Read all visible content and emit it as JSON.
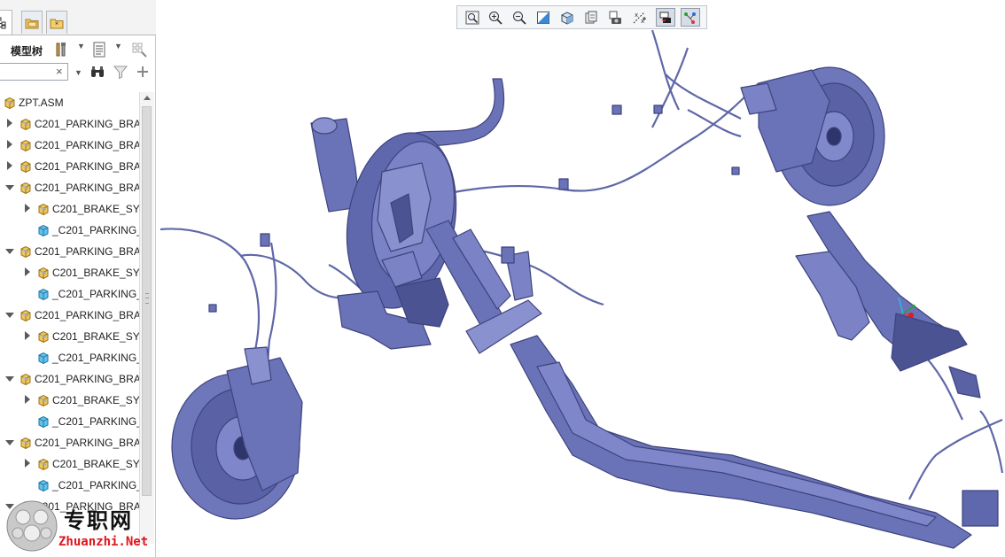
{
  "panel": {
    "tree_title": "模型树",
    "filter_value": "",
    "clear_symbol": "×"
  },
  "tree": {
    "rows": [
      {
        "level": 0,
        "expander": "none",
        "icon": "assembly-icon",
        "label": "ZPT.ASM"
      },
      {
        "level": 0,
        "expander": "right",
        "icon": "assembly-icon",
        "label": "C201_PARKING_BRA"
      },
      {
        "level": 0,
        "expander": "right",
        "icon": "assembly-icon",
        "label": "C201_PARKING_BRA"
      },
      {
        "level": 0,
        "expander": "right",
        "icon": "assembly-icon",
        "label": "C201_PARKING_BRA"
      },
      {
        "level": 0,
        "expander": "down",
        "icon": "assembly-icon",
        "label": "C201_PARKING_BRA"
      },
      {
        "level": 1,
        "expander": "right",
        "icon": "assembly-icon",
        "label": "C201_BRAKE_SYS"
      },
      {
        "level": 1,
        "expander": "none",
        "icon": "part-icon",
        "label": "_C201_PARKING_"
      },
      {
        "level": 0,
        "expander": "down",
        "icon": "assembly-icon",
        "label": "C201_PARKING_BRA"
      },
      {
        "level": 1,
        "expander": "right",
        "icon": "assembly-icon",
        "label": "C201_BRAKE_SYS"
      },
      {
        "level": 1,
        "expander": "none",
        "icon": "part-icon",
        "label": "_C201_PARKING_"
      },
      {
        "level": 0,
        "expander": "down",
        "icon": "assembly-icon",
        "label": "C201_PARKING_BRA"
      },
      {
        "level": 1,
        "expander": "right",
        "icon": "assembly-icon",
        "label": "C201_BRAKE_SYS"
      },
      {
        "level": 1,
        "expander": "none",
        "icon": "part-icon",
        "label": "_C201_PARKING_"
      },
      {
        "level": 0,
        "expander": "down",
        "icon": "assembly-icon",
        "label": "C201_PARKING_BRA"
      },
      {
        "level": 1,
        "expander": "right",
        "icon": "assembly-icon",
        "label": "C201_BRAKE_SYS"
      },
      {
        "level": 1,
        "expander": "none",
        "icon": "part-icon",
        "label": "_C201_PARKING_"
      },
      {
        "level": 0,
        "expander": "down",
        "icon": "assembly-icon",
        "label": "C201_PARKING_BRA"
      },
      {
        "level": 1,
        "expander": "right",
        "icon": "assembly-icon",
        "label": "C201_BRAKE_SYS"
      },
      {
        "level": 1,
        "expander": "none",
        "icon": "part-icon",
        "label": "_C201_PARKING_"
      },
      {
        "level": 0,
        "expander": "down",
        "icon": "assembly-icon",
        "label": "C201_PARKING_BRA"
      }
    ]
  },
  "graphics_toolbar": {
    "buttons": [
      {
        "name": "refit-button",
        "icon": "zoom-fit-icon"
      },
      {
        "name": "zoom-in-button",
        "icon": "zoom-in-icon"
      },
      {
        "name": "zoom-out-button",
        "icon": "zoom-out-icon"
      },
      {
        "name": "repaint-button",
        "icon": "repaint-icon"
      },
      {
        "name": "display-style-button",
        "icon": "shaded-cube-icon"
      },
      {
        "name": "saved-views-button",
        "icon": "saved-views-icon"
      },
      {
        "name": "view-manager-button",
        "icon": "camera-icon"
      },
      {
        "name": "datum-display-button",
        "icon": "datum-display-icon"
      },
      {
        "name": "spin-center-button",
        "icon": "spin-center-icon"
      },
      {
        "name": "annotation-display-button",
        "icon": "annotation-icon"
      }
    ]
  },
  "colors": {
    "model": "#6b73b8",
    "model_dark": "#3d437d",
    "model_light": "#9aa2dc",
    "assembly_icon": "#e8b64a",
    "part_icon": "#4fb3e0"
  },
  "watermark": {
    "cn": "专职网",
    "en": "Zhuanzhi.Net"
  }
}
